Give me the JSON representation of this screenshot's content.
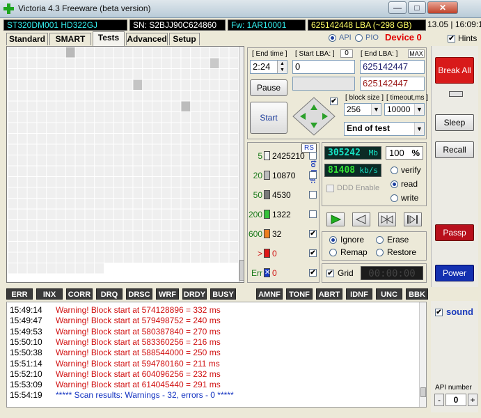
{
  "window": {
    "title": "Victoria 4.3 Freeware (beta version)",
    "controls": {
      "minimize": "—",
      "maximize": "□",
      "close": "✕"
    }
  },
  "info": {
    "model": "ST320DM001 HD322GJ",
    "serial": "SN: S2BJJ90C624860",
    "firmware": "Fw: 1AR10001",
    "lba": "625142448 LBA (~298 GB)",
    "clock": "13.05 | 16:09:1"
  },
  "tabs": [
    {
      "label": "Standard"
    },
    {
      "label": "SMART"
    },
    {
      "label": "Tests",
      "active": true
    },
    {
      "label": "Advanced"
    },
    {
      "label": "Setup"
    }
  ],
  "mode": {
    "api": "API",
    "pio": "PIO",
    "device": "Device 0",
    "hints": "Hints"
  },
  "grid": {
    "rows": 21,
    "cols": 24,
    "last_row_filled": 10,
    "marked": [
      {
        "r": 0,
        "c": 6,
        "shade": "#b9b9b9"
      },
      {
        "r": 1,
        "c": 21,
        "shade": "#c9c9c9"
      },
      {
        "r": 3,
        "c": 13,
        "shade": "#c4c4c4"
      },
      {
        "r": 5,
        "c": 18,
        "shade": "#bcbcbc"
      }
    ]
  },
  "controls": {
    "end_time_label": "[ End time ]",
    "end_time_value": "2:24",
    "start_lba_label": "[ Start LBA: ]",
    "start_lba_counter": "0",
    "start_lba_value": "0",
    "end_lba_label": "[ End LBA: ]",
    "end_lba_max": "MAX",
    "end_lba_value": "625142447",
    "current_lba_value": "625142447",
    "pause_label": "Pause",
    "start_label": "Start",
    "block_size_label": "[ block size ]",
    "block_size_value": "256",
    "timeout_label": "[ timeout,ms ]",
    "timeout_value": "10000",
    "end_action_value": "End of test"
  },
  "legend": {
    "rs": "RS",
    "to_log": "to log:",
    "items": [
      {
        "ms": "5",
        "count": "2425210",
        "color": "#f2f2f2",
        "logged": false
      },
      {
        "ms": "20",
        "count": "10870",
        "color": "#bdbdbd",
        "logged": false
      },
      {
        "ms": "50",
        "count": "4530",
        "color": "#7a7a7a",
        "logged": false
      },
      {
        "ms": "200",
        "count": "1322",
        "color": "#35c23a",
        "logged": false
      },
      {
        "ms": "600",
        "count": "32",
        "color": "#ee7f1d",
        "logged": true
      },
      {
        "ms": ">",
        "count": "0",
        "color": "#e01818",
        "logged": true
      },
      {
        "ms": "Err",
        "count": "0",
        "color": "#1a3cc8",
        "logged": true
      }
    ]
  },
  "speed": {
    "position": "305242",
    "position_unit": "Mb",
    "percent": "100",
    "percent_unit": "%",
    "rate": "81408",
    "rate_unit": "kb/s",
    "ddd_label": "DDD Enable",
    "verify": "verify",
    "read": "read",
    "write": "write",
    "selected": "read"
  },
  "repair": {
    "ignore": "Ignore",
    "erase": "Erase",
    "remap": "Remap",
    "restore": "Restore",
    "selected": "Ignore",
    "grid_label": "Grid",
    "timer": "00:00:00"
  },
  "side": {
    "break_all": "Break All",
    "sleep": "Sleep",
    "recall": "Recall",
    "passp": "Passp",
    "power": "Power",
    "sound": "sound",
    "api_number_label": "API number",
    "api_number_value": "0",
    "minus": "-",
    "plus": "+"
  },
  "status_flags": [
    "ERR",
    "INX",
    "CORR",
    "DRQ",
    "DRSC",
    "WRF",
    "DRDY",
    "BUSY",
    "AMNF",
    "TONF",
    "ABRT",
    "IDNF",
    "UNC",
    "BBK"
  ],
  "log": [
    {
      "time": "15:49:14",
      "text": "Warning! Block start at 574128896 = 332 ms",
      "kind": "warn"
    },
    {
      "time": "15:49:47",
      "text": "Warning! Block start at 579498752 = 240 ms",
      "kind": "warn"
    },
    {
      "time": "15:49:53",
      "text": "Warning! Block start at 580387840 = 270 ms",
      "kind": "warn"
    },
    {
      "time": "15:50:10",
      "text": "Warning! Block start at 583360256 = 216 ms",
      "kind": "warn"
    },
    {
      "time": "15:50:38",
      "text": "Warning! Block start at 588544000 = 250 ms",
      "kind": "warn"
    },
    {
      "time": "15:51:14",
      "text": "Warning! Block start at 594780160 = 211 ms",
      "kind": "warn"
    },
    {
      "time": "15:52:10",
      "text": "Warning! Block start at 604096256 = 232 ms",
      "kind": "warn"
    },
    {
      "time": "15:53:09",
      "text": "Warning! Block start at 614045440 = 291 ms",
      "kind": "warn"
    },
    {
      "time": "15:54:19",
      "text": "***** Scan results: Warnings - 32, errors - 0 *****",
      "kind": "result"
    }
  ],
  "colors": {
    "warn": "#d01010",
    "result": "#1030c0",
    "device": "#e00000",
    "break_all_bg": "#d81a1a",
    "passp_bg": "#b8101c",
    "power_bg": "#1430b0"
  }
}
